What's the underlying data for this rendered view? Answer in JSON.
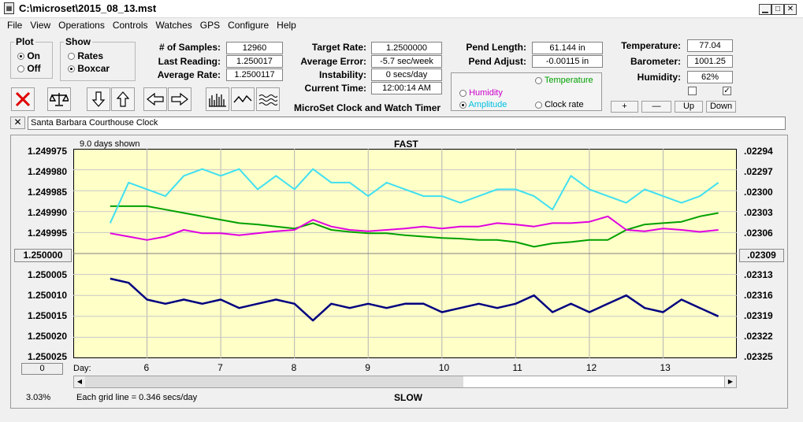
{
  "window": {
    "title": "C:\\microset\\2015_08_13.mst",
    "minimize_icon": "minimize-icon",
    "maximize_icon": "maximize-icon",
    "close_icon": "close-icon"
  },
  "menu": [
    "File",
    "View",
    "Operations",
    "Controls",
    "Watches",
    "GPS",
    "Configure",
    "Help"
  ],
  "plot": {
    "legend": "Plot",
    "on": "On",
    "off": "Off",
    "selected": "On"
  },
  "show": {
    "legend": "Show",
    "rates": "Rates",
    "boxcar": "Boxcar",
    "selected": "Boxcar"
  },
  "stats": {
    "samples_label": "# of Samples:",
    "samples": "12960",
    "last_label": "Last Reading:",
    "last": "1.250017",
    "avg_rate_label": "Average Rate:",
    "avg_rate": "1.2500117",
    "target_label": "Target Rate:",
    "target": "1.2500000",
    "avg_err_label": "Average Error:",
    "avg_err": "-5.7 sec/week",
    "instab_label": "Instability:",
    "instab": "0 secs/day",
    "time_label": "Current Time:",
    "time": "12:00:14 AM",
    "pend_len_label": "Pend Length:",
    "pend_len": "61.144 in",
    "pend_adj_label": "Pend Adjust:",
    "pend_adj": "-0.00115 in",
    "temp_label": "Temperature:",
    "temp": "77.04",
    "baro_label": "Barometer:",
    "baro": "1001.25",
    "hum_label": "Humidity:",
    "hum": "62%"
  },
  "app_name": "MicroSet Clock and Watch Timer",
  "secondary": {
    "humidity": "Humidity",
    "temperature": "Temperature",
    "amplitude": "Amplitude",
    "clock_rate": "Clock rate",
    "selected": "Amplitude",
    "colors": {
      "humidity": "#cc00cc",
      "temperature": "#00a000",
      "amplitude": "#00c0e0"
    }
  },
  "checks": [
    false,
    true
  ],
  "adjust_buttons": [
    "+",
    "—",
    "Up",
    "Down"
  ],
  "toolbar_icons": [
    "exit-x-icon",
    "balance-scale-icon",
    "arrow-down-icon",
    "arrow-up-icon",
    "arrow-left-icon",
    "arrow-right-icon",
    "histogram-icon",
    "wave-icon",
    "multi-wave-icon"
  ],
  "clock_name": "Santa Barbara Courthouse Clock",
  "graph": {
    "days_shown": "9.0 days shown",
    "fast": "FAST",
    "slow": "SLOW",
    "day_label": "Day:",
    "grid_note": "Each grid line = 0.346 secs/day",
    "percent": "3.03%",
    "left_button": "1.250000",
    "right_button": ".02309",
    "bottom_button": "0",
    "plot_bg": "#ffffc8"
  },
  "chart_data": {
    "type": "line",
    "x": [
      5.5,
      5.75,
      6.0,
      6.25,
      6.5,
      6.75,
      7.0,
      7.25,
      7.5,
      7.75,
      8.0,
      8.25,
      8.5,
      8.75,
      9.0,
      9.25,
      9.5,
      9.75,
      10.0,
      10.25,
      10.5,
      10.75,
      11.0,
      11.25,
      11.5,
      11.75,
      12.0,
      12.25,
      12.5,
      12.75,
      13.0,
      13.25,
      13.5,
      13.75
    ],
    "x_ticks": [
      6,
      7,
      8,
      9,
      10,
      11,
      12,
      13
    ],
    "y_left_ticks": [
      "1.249975",
      "1.249980",
      "1.249985",
      "1.249990",
      "1.249995",
      "1.250000",
      "1.250005",
      "1.250010",
      "1.250015",
      "1.250020",
      "1.250025"
    ],
    "y_right_ticks": [
      ".02294",
      ".02297",
      ".02300",
      ".02303",
      ".02306",
      ".02309",
      ".02313",
      ".02316",
      ".02319",
      ".02322",
      ".02325"
    ],
    "series": [
      {
        "color": "#000080",
        "axis": "left",
        "values": [
          1.250006,
          1.250007,
          1.250011,
          1.250012,
          1.250011,
          1.250012,
          1.250011,
          1.250013,
          1.250012,
          1.250011,
          1.250012,
          1.250016,
          1.250012,
          1.250013,
          1.250012,
          1.250013,
          1.250012,
          1.250012,
          1.250014,
          1.250013,
          1.250012,
          1.250013,
          1.250012,
          1.25001,
          1.250014,
          1.250012,
          1.250014,
          1.250012,
          1.25001,
          1.250013,
          1.250014,
          1.250011,
          1.250013,
          1.250015
        ]
      },
      {
        "color": "#40e0f0",
        "axis": "right",
        "values": [
          0.02305,
          0.02299,
          0.023,
          0.02301,
          0.02298,
          0.02297,
          0.02298,
          0.02297,
          0.023,
          0.02298,
          0.023,
          0.02297,
          0.02299,
          0.02299,
          0.02301,
          0.02299,
          0.023,
          0.02301,
          0.02301,
          0.02302,
          0.02301,
          0.023,
          0.023,
          0.02301,
          0.02303,
          0.02298,
          0.023,
          0.02301,
          0.02302,
          0.023,
          0.02301,
          0.02302,
          0.02301,
          0.02299
        ]
      },
      {
        "color": "#00a000",
        "axis": "right",
        "values": [
          0.023025,
          0.023025,
          0.023025,
          0.02303,
          0.023035,
          0.02304,
          0.023045,
          0.02305,
          0.023052,
          0.023055,
          0.023058,
          0.02305,
          0.02306,
          0.023063,
          0.023065,
          0.023065,
          0.023068,
          0.02307,
          0.023072,
          0.023073,
          0.023075,
          0.023075,
          0.023078,
          0.023085,
          0.02308,
          0.023078,
          0.023075,
          0.023075,
          0.02306,
          0.023052,
          0.02305,
          0.023048,
          0.02304,
          0.023035
        ]
      },
      {
        "color": "#e000e0",
        "axis": "right",
        "values": [
          0.023065,
          0.02307,
          0.023075,
          0.02307,
          0.02306,
          0.023065,
          0.023065,
          0.023068,
          0.023065,
          0.023062,
          0.02306,
          0.023045,
          0.023055,
          0.02306,
          0.023062,
          0.02306,
          0.023058,
          0.023055,
          0.023058,
          0.023055,
          0.023055,
          0.02305,
          0.023052,
          0.023055,
          0.02305,
          0.02305,
          0.023048,
          0.02304,
          0.02306,
          0.023062,
          0.023058,
          0.02306,
          0.023063,
          0.02306
        ]
      }
    ]
  }
}
